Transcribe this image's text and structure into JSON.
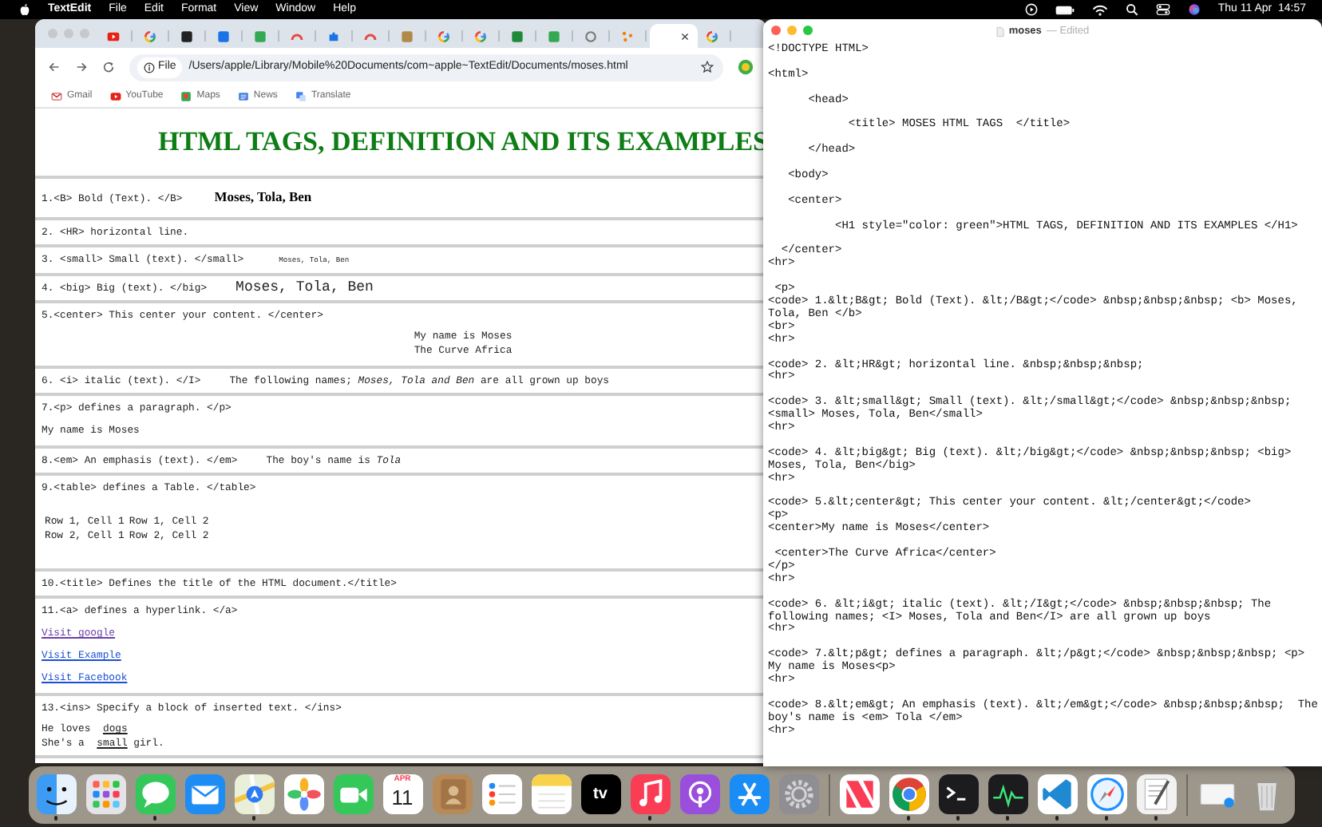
{
  "menubar": {
    "app": "TextEdit",
    "menus": [
      "File",
      "Edit",
      "Format",
      "View",
      "Window",
      "Help"
    ],
    "clock": "Thu 11 Apr  14:57"
  },
  "browser": {
    "tabs": [
      {
        "kind": "play",
        "color": "#e62117",
        "selected": false
      },
      {
        "kind": "g",
        "selected": false
      },
      {
        "kind": "square",
        "color": "#222222",
        "selected": false
      },
      {
        "kind": "square",
        "color": "#1a73e8",
        "selected": false
      },
      {
        "kind": "square",
        "color": "#34a853",
        "selected": false
      },
      {
        "kind": "arc",
        "color": "#e8453c",
        "selected": false
      },
      {
        "kind": "puzzle",
        "color": "#1a73e8",
        "selected": false
      },
      {
        "kind": "arc",
        "color": "#e8453c",
        "selected": false
      },
      {
        "kind": "square",
        "color": "#b08a4a",
        "selected": false
      },
      {
        "kind": "g",
        "selected": false
      },
      {
        "kind": "g",
        "selected": false
      },
      {
        "kind": "square",
        "color": "#1f8a3a",
        "selected": false
      },
      {
        "kind": "square",
        "color": "#34a853",
        "selected": false
      },
      {
        "kind": "ring",
        "color": "#777777",
        "selected": false
      },
      {
        "kind": "dots",
        "color": "#f57c00",
        "selected": false
      },
      {
        "kind": "blank",
        "selected": true
      },
      {
        "kind": "g",
        "selected": false
      }
    ],
    "address": {
      "chip": "File",
      "url": "/Users/apple/Library/Mobile%20Documents/com~apple~TextEdit/Documents/moses.html"
    },
    "bookmarks": [
      {
        "kind": "mail",
        "label": "Gmail"
      },
      {
        "kind": "play",
        "label": "YouTube"
      },
      {
        "kind": "pin",
        "label": "Maps"
      },
      {
        "kind": "news",
        "label": "News"
      },
      {
        "kind": "translate",
        "label": "Translate"
      }
    ],
    "page": {
      "heading": "HTML TAGS, DEFINITION AND ITS EXAMPLES",
      "sections": [
        {
          "code": "1.<B> Bold (Text). </B>",
          "sample": "Moses, Tola, Ben",
          "kind": "bold"
        },
        {
          "code": "2. <HR> horizontal line."
        },
        {
          "code": "3. <small> Small (text). </small>",
          "sample": "Moses, Tola, Ben",
          "kind": "small"
        },
        {
          "code": "4. <big> Big (text). </big>",
          "sample": "Moses, Tola, Ben",
          "kind": "big"
        },
        {
          "code": "5.<center> This center your content. </center>",
          "content": [
            {
              "kind": "center",
              "text": "My name is Moses"
            },
            {
              "kind": "center",
              "text": "The Curve Africa"
            }
          ]
        },
        {
          "code": "6. <i> italic (text). </I>",
          "sample": "The following names; *Moses, Tola and Ben* are all grown up boys",
          "kind": "plain"
        },
        {
          "code": "7.<p> defines a paragraph. </p>",
          "content": [
            {
              "kind": "text",
              "text": "My name is Moses"
            }
          ]
        },
        {
          "code": "8.<em> An emphasis (text). </em>",
          "sample": "The boy's name is *Tola*",
          "kind": "plain"
        },
        {
          "code": "9.<table> defines a Table. </table>",
          "content": [
            {
              "kind": "table",
              "rows": [
                [
                  "Row 1, Cell 1",
                  "Row 1, Cell 2"
                ],
                [
                  "Row 2, Cell 1",
                  "Row 2, Cell 2"
                ]
              ]
            }
          ]
        },
        {
          "code": "10.<title> Defines the title of the HTML document.</title>"
        },
        {
          "code": "11.<a> defines a hyperlink. </a>",
          "content": [
            {
              "kind": "link",
              "text": "Visit google",
              "visited": true
            },
            {
              "kind": "link",
              "text": "Visit Example",
              "visited": false
            },
            {
              "kind": "link",
              "text": "Visit Facebook",
              "visited": false
            }
          ]
        },
        {
          "code": "13.<ins> Specify a block of inserted text. </ins>",
          "content": [
            {
              "kind": "ins",
              "before": "He loves",
              "inserted": "dogs"
            },
            {
              "kind": "ins",
              "before": "She's a",
              "inserted": "small",
              "after": "girl."
            }
          ]
        }
      ]
    }
  },
  "textedit": {
    "title": "moses",
    "status": "— Edited",
    "paragraphs": [
      [
        "<!DOCTYPE HTML>"
      ],
      [
        "<html>"
      ],
      [
        "      <head>"
      ],
      [
        "            <title> MOSES HTML TAGS  </title>"
      ],
      [
        "      </head>"
      ],
      [
        "   <body>"
      ],
      [
        "   <center>"
      ],
      [
        "          <H1 style=\"color: green\">HTML TAGS, DEFINITION AND ITS EXAMPLES </H1>"
      ],
      [
        "  </center>",
        "<hr>"
      ],
      [
        " <p>",
        "<code> 1.&lt;B&gt; Bold (Text). &lt;/B&gt;</code> &nbsp;&nbsp;&nbsp; <b> Moses,",
        "Tola, Ben </b>",
        "<br>",
        "<hr>"
      ],
      [
        "<code> 2. &lt;HR&gt; horizontal line. &nbsp;&nbsp;&nbsp;",
        "<hr>"
      ],
      [
        "<code> 3. &lt;small&gt; Small (text). &lt;/small&gt;</code> &nbsp;&nbsp;&nbsp;",
        "<small> Moses, Tola, Ben</small>",
        "<hr>"
      ],
      [
        "<code> 4. &lt;big&gt; Big (text). &lt;/big&gt;</code> &nbsp;&nbsp;&nbsp; <big>",
        "Moses, Tola, Ben</big>",
        "<hr>"
      ],
      [
        "<code> 5.&lt;center&gt; This center your content. &lt;/center&gt;</code>",
        "<p>",
        "<center>My name is Moses</center>"
      ],
      [
        " <center>The Curve Africa</center>",
        "</p>",
        "<hr>"
      ],
      [
        "<code> 6. &lt;i&gt; italic (text). &lt;/I&gt;</code> &nbsp;&nbsp;&nbsp; The",
        "following names; <I> Moses, Tola and Ben</I> are all grown up boys",
        "<hr>"
      ],
      [
        "<code> 7.&lt;p&gt; defines a paragraph. &lt;/p&gt;</code> &nbsp;&nbsp;&nbsp; <p>",
        "My name is Moses<p>",
        "<hr>"
      ],
      [
        "<code> 8.&lt;em&gt; An emphasis (text). &lt;/em&gt;</code> &nbsp;&nbsp;&nbsp;  The",
        "boy's name is <em> Tola </em>",
        "<hr>"
      ]
    ]
  },
  "dock": {
    "apps": [
      {
        "kind": "finder",
        "running": true
      },
      {
        "kind": "launchpad",
        "running": false
      },
      {
        "kind": "messages",
        "running": true
      },
      {
        "kind": "mail",
        "running": false
      },
      {
        "kind": "maps",
        "running": true
      },
      {
        "kind": "photos",
        "running": false
      },
      {
        "kind": "facetime",
        "running": false
      },
      {
        "kind": "calendar",
        "month": "APR",
        "day": "11",
        "running": false
      },
      {
        "kind": "contacts",
        "running": false
      },
      {
        "kind": "reminders",
        "running": false
      },
      {
        "kind": "notes",
        "running": false
      },
      {
        "kind": "tv",
        "label": "tv",
        "running": false
      },
      {
        "kind": "music",
        "running": true
      },
      {
        "kind": "podcasts",
        "running": false
      },
      {
        "kind": "appstore",
        "running": false
      },
      {
        "kind": "settings",
        "running": false
      }
    ],
    "recent": [
      {
        "kind": "news",
        "running": false
      },
      {
        "kind": "chrome",
        "running": true
      },
      {
        "kind": "terminal",
        "running": true
      },
      {
        "kind": "activity",
        "running": true
      },
      {
        "kind": "vscode",
        "running": true
      },
      {
        "kind": "safari",
        "running": true
      },
      {
        "kind": "textedit",
        "running": true
      }
    ],
    "stacks": [
      {
        "kind": "docstack",
        "running": false
      },
      {
        "kind": "trash",
        "running": false
      }
    ]
  }
}
